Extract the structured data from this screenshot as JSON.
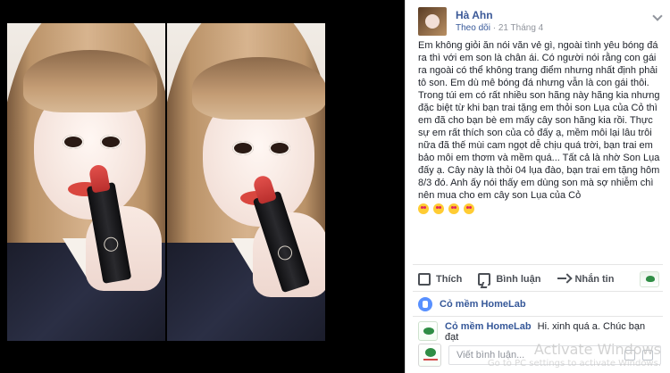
{
  "post": {
    "author": "Hà Ahn",
    "follow": "Theo dõi",
    "dot": "·",
    "date": "21 Tháng 4",
    "text": "Em không giỏi ăn nói văn vẻ gì, ngoài tình yêu bóng đá ra thì với em son là chân ái. Có người nói rằng con gái ra ngoài có thể không trang điểm nhưng nhất định phải tô son. Em dù mê bóng đá nhưng vẫn là con gái thôi. Trong túi em có rất nhiều son hãng này hãng kia nhưng đặc biệt từ khi bạn trai tặng em thỏi son Lụa của Cỏ thì em đã cho bạn bè em mấy cây son hãng kia rồi. Thực sự em rất thích son của cỏ đấy ạ, mềm môi lại lâu trôi nữa đã thế mùi cam ngọt dễ chịu quá trời, bạn trai em bảo môi em thơm và mềm quá... Tất cả là nhờ Son Lụa đấy ạ. Cây này là thỏi 04 lụa đào, bạn trai em tặng hôm 8/3 đó. Anh ấy nói thấy em dùng son mà sợ nhiễm chì nên mua cho em cây son Lụa của Cỏ",
    "emojis": [
      "smiling-face-with-heart-eyes",
      "smiling-face-with-heart-eyes",
      "smiling-face-with-heart-eyes",
      "smiling-face-with-heart-eyes"
    ]
  },
  "actions": {
    "like": "Thích",
    "comment": "Bình luận",
    "share": "Nhắn tin"
  },
  "reactions": {
    "name": "Cỏ mềm HomeLab"
  },
  "comment": {
    "author": "Cỏ mềm HomeLab",
    "text": "Hi. xinh quá a. Chúc bạn đạt"
  },
  "write": {
    "placeholder": "Viết bình luận..."
  },
  "watermark": {
    "title": "Activate Windows",
    "subtitle": "Go to PC settings to activate Windows."
  }
}
